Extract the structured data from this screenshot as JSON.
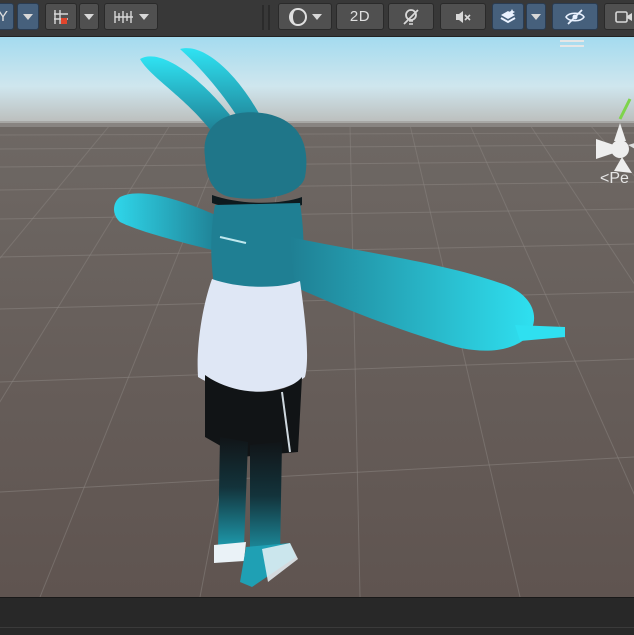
{
  "toolbar": {
    "left_clip_label": "Y",
    "toggle_2d_label": "2D"
  },
  "gizmo": {
    "projection_label": "<Pe"
  },
  "icons": {
    "transform": "transform-tool-icon",
    "grid": "grid-snap-icon",
    "increment": "increment-snap-icon",
    "shading": "shading-mode-icon",
    "lighting": "lighting-toggle-icon",
    "audio": "audio-mute-icon",
    "effects": "effects-layers-icon",
    "visibility": "scene-visibility-icon",
    "camera": "camera-icon"
  },
  "colors": {
    "toolbar_bg": "#383838",
    "button_bg": "#505050",
    "active_button_bg": "#46607c",
    "sky_top": "#a8dcef",
    "ground": "#675e5a",
    "character_teal": "#1f7f93",
    "character_cyan": "#2bd3e8"
  }
}
